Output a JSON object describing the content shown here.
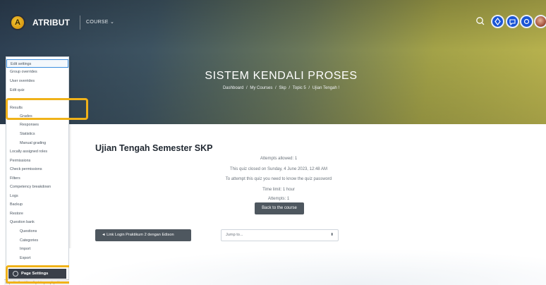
{
  "navbar": {
    "brand": "ATRIBUT",
    "logo_letter": "A",
    "course_menu": "COURSE ⌄",
    "icons": [
      "search-icon",
      "notification-icon",
      "messages-icon",
      "settings-icon",
      "avatar"
    ]
  },
  "hero": {
    "title": "SISTEM KENDALI PROSES",
    "breadcrumbs": [
      "Dashboard",
      "My Courses",
      "Skp",
      "Topic 5",
      "Ujian Tengah !"
    ],
    "separator": "/"
  },
  "sidebar": {
    "items": [
      {
        "label": "Edit settings",
        "sub": false,
        "active": true
      },
      {
        "label": "Group overrides",
        "sub": false
      },
      {
        "label": "User overrides",
        "sub": false
      },
      {
        "label": "Edit quiz",
        "sub": false
      },
      {
        "label": "Results",
        "sub": false
      },
      {
        "label": "Grades",
        "sub": true
      },
      {
        "label": "Responses",
        "sub": true
      },
      {
        "label": "Statistics",
        "sub": true
      },
      {
        "label": "Manual grading",
        "sub": true
      },
      {
        "label": "Locally assigned roles",
        "sub": false
      },
      {
        "label": "Permissions",
        "sub": false
      },
      {
        "label": "Check permissions",
        "sub": false
      },
      {
        "label": "Filters",
        "sub": false
      },
      {
        "label": "Competency breakdown",
        "sub": false
      },
      {
        "label": "Logs",
        "sub": false
      },
      {
        "label": "Backup",
        "sub": false
      },
      {
        "label": "Restore",
        "sub": false
      },
      {
        "label": "Question bank",
        "sub": false
      },
      {
        "label": "Questions",
        "sub": true
      },
      {
        "label": "Categories",
        "sub": true
      },
      {
        "label": "Import",
        "sub": true
      },
      {
        "label": "Export",
        "sub": true
      }
    ],
    "page_settings": "Page Settings"
  },
  "status_url": "https://atribut.id/mod/quiz/report.php?id=14126&mode=overview",
  "main": {
    "quiz_title": "Ujian Tengah Semester SKP",
    "info_lines": [
      "Attempts allowed: 1",
      "This quiz closed on Sunday, 4 June 2023, 12:48 AM",
      "To attempt this quiz you need to know the quiz password",
      "Time limit: 1 hour",
      "Attempts: 1"
    ],
    "back_button": "Back to the course",
    "prev_activity": "◄ Link Login Praktikum 2 dengan Edison",
    "jump_placeholder": "Jump to...",
    "jump_arrow": "⬍"
  },
  "colors": {
    "highlight": "#f0b219",
    "button_dark": "#4e575f",
    "nav_icon_blue": "#1a55d6"
  }
}
